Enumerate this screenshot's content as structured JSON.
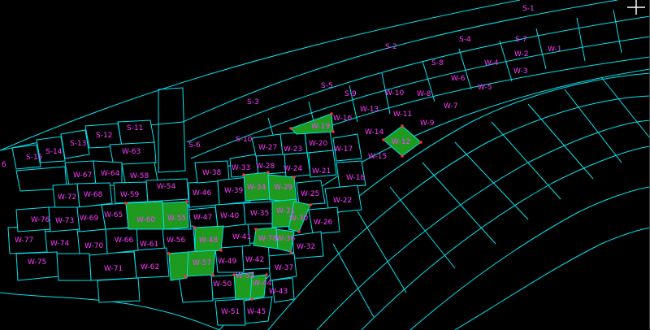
{
  "drawing": {
    "background_color": "#000000",
    "outline_color": "#00e5f0",
    "label_color": "#ff3cff",
    "selected_fill": "#1e9a1e",
    "vertex_color": "#ff3030"
  },
  "labels": {
    "s1": "S-1",
    "s2": "S-2",
    "s3": "S-3",
    "s4": "S-4",
    "s5": "S-5",
    "s6": "S-6",
    "s7": "S-7",
    "s8": "S-8",
    "s9": "S-9",
    "s10": "S-10",
    "s11": "S-11",
    "s12": "S-12",
    "s13": "S-13",
    "s14": "S-14",
    "s15": "S-15",
    "s_edge": "6",
    "w1": "W-1",
    "w2": "W-2",
    "w3": "W-3",
    "w4": "W-4",
    "w5": "W-5",
    "w6": "W-6",
    "w7": "W-7",
    "w8": "W-8",
    "w9": "W-9",
    "w10": "W-10",
    "w11": "W-11",
    "w12": "W-12",
    "w13": "W-13",
    "w14": "W-14",
    "w15": "W-15",
    "w16": "W-16",
    "w17": "W-17",
    "w18": "W-18",
    "w19": "W-19",
    "w20": "W-20",
    "w21": "W-21",
    "w22": "W-22",
    "w23": "W-23",
    "w24": "W-24",
    "w25": "W-25",
    "w26": "W-26",
    "w27": "W-27",
    "w28": "W-28",
    "w29": "W-29",
    "w30": "W-30",
    "w31": "W-31",
    "w32": "W-32",
    "w33": "W-33",
    "w34": "W-34",
    "w35": "W-35",
    "w36": "W-36",
    "w37": "W-37",
    "w38": "W-38",
    "w39": "W-39",
    "w40": "W-40",
    "w41": "W-41",
    "w42": "W-42",
    "w43": "W-43",
    "w44": "W-44",
    "w45": "W-45",
    "w46": "W-46",
    "w47": "W-47",
    "w48": "W-48",
    "w49": "W-49",
    "w50": "W-50",
    "w51": "W-51",
    "w52": "W-52",
    "w54": "W-54",
    "w55": "W-55",
    "w56": "W-56",
    "w57": "W-57",
    "w58": "W-58",
    "w59": "W-59",
    "w60": "W-60",
    "w61": "W-61",
    "w62": "W-62",
    "w63": "W-63",
    "w64": "W-64",
    "w65": "W-65",
    "w66": "W-66",
    "w67": "W-67",
    "w68": "W-68",
    "w69": "W-69",
    "w70": "W-70",
    "w71": "W-71",
    "w72": "W-72",
    "w73": "W-73",
    "w74": "W-74",
    "w75": "W-75",
    "w76": "W-76",
    "w77": "W-77",
    "w78": "W-78"
  }
}
